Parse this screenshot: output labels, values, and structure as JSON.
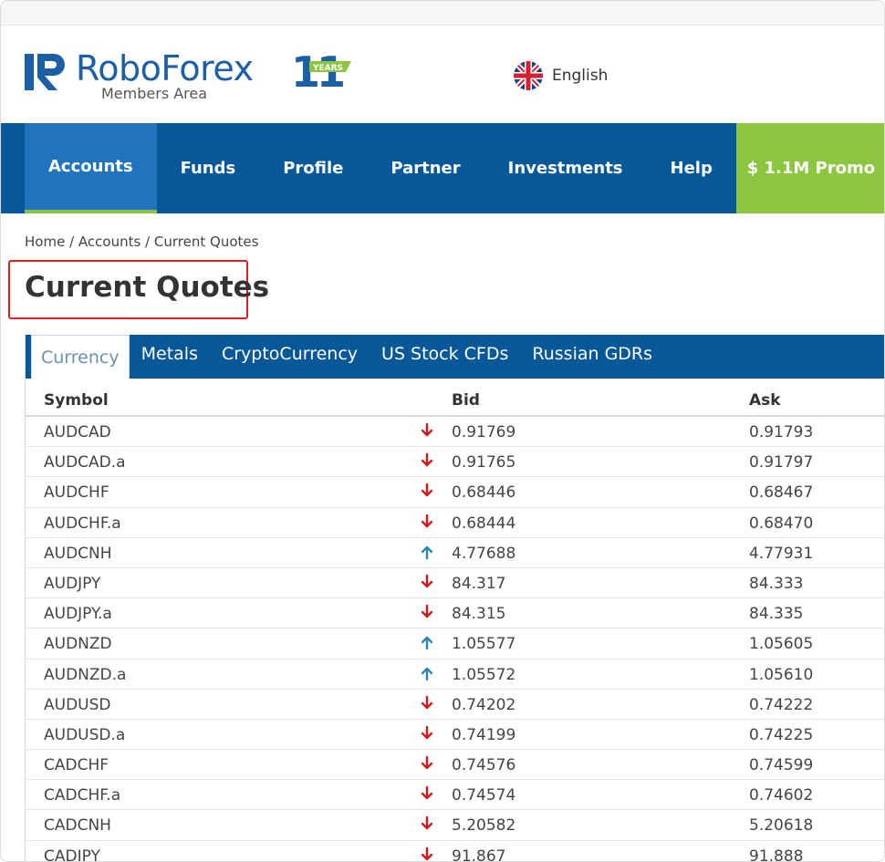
{
  "brand": {
    "name": "RoboForex",
    "subtitle": "Members Area",
    "years_number": "11",
    "years_label": "YEARS",
    "color": "#1c5fa6",
    "accent": "#8cc63f"
  },
  "language": {
    "label": "English",
    "icon": "uk-flag-icon"
  },
  "nav": {
    "items": [
      {
        "label": "Accounts",
        "active": true
      },
      {
        "label": "Funds"
      },
      {
        "label": "Profile"
      },
      {
        "label": "Partner"
      },
      {
        "label": "Investments"
      },
      {
        "label": "Help"
      }
    ],
    "promo_label": "$ 1.1M Promo",
    "background": "#065899"
  },
  "breadcrumb": {
    "home": "Home",
    "accounts": "Accounts",
    "current": "Current Quotes",
    "separator": "/"
  },
  "page_title": "Current Quotes",
  "tabs": [
    {
      "label": "Currency",
      "active": true
    },
    {
      "label": "Metals"
    },
    {
      "label": "CryptoCurrency"
    },
    {
      "label": "US Stock CFDs"
    },
    {
      "label": "Russian GDRs"
    }
  ],
  "table": {
    "headers": {
      "symbol": "Symbol",
      "bid": "Bid",
      "ask": "Ask"
    },
    "rows": [
      {
        "symbol": "AUDCAD",
        "dir": "down",
        "bid": "0.91769",
        "ask": "0.91793"
      },
      {
        "symbol": "AUDCAD.a",
        "dir": "down",
        "bid": "0.91765",
        "ask": "0.91797"
      },
      {
        "symbol": "AUDCHF",
        "dir": "down",
        "bid": "0.68446",
        "ask": "0.68467"
      },
      {
        "symbol": "AUDCHF.a",
        "dir": "down",
        "bid": "0.68444",
        "ask": "0.68470"
      },
      {
        "symbol": "AUDCNH",
        "dir": "up",
        "bid": "4.77688",
        "ask": "4.77931"
      },
      {
        "symbol": "AUDJPY",
        "dir": "down",
        "bid": "84.317",
        "ask": "84.333"
      },
      {
        "symbol": "AUDJPY.a",
        "dir": "down",
        "bid": "84.315",
        "ask": "84.335"
      },
      {
        "symbol": "AUDNZD",
        "dir": "up",
        "bid": "1.05577",
        "ask": "1.05605"
      },
      {
        "symbol": "AUDNZD.a",
        "dir": "up",
        "bid": "1.05572",
        "ask": "1.05610"
      },
      {
        "symbol": "AUDUSD",
        "dir": "down",
        "bid": "0.74202",
        "ask": "0.74222"
      },
      {
        "symbol": "AUDUSD.a",
        "dir": "down",
        "bid": "0.74199",
        "ask": "0.74225"
      },
      {
        "symbol": "CADCHF",
        "dir": "down",
        "bid": "0.74576",
        "ask": "0.74599"
      },
      {
        "symbol": "CADCHF.a",
        "dir": "down",
        "bid": "0.74574",
        "ask": "0.74602"
      },
      {
        "symbol": "CADCNH",
        "dir": "down",
        "bid": "5.20582",
        "ask": "5.20618"
      },
      {
        "symbol": "CADJPY",
        "dir": "down",
        "bid": "91.867",
        "ask": "91.888"
      }
    ],
    "colors": {
      "down": "#d21a1a",
      "up": "#2a87b3"
    }
  }
}
